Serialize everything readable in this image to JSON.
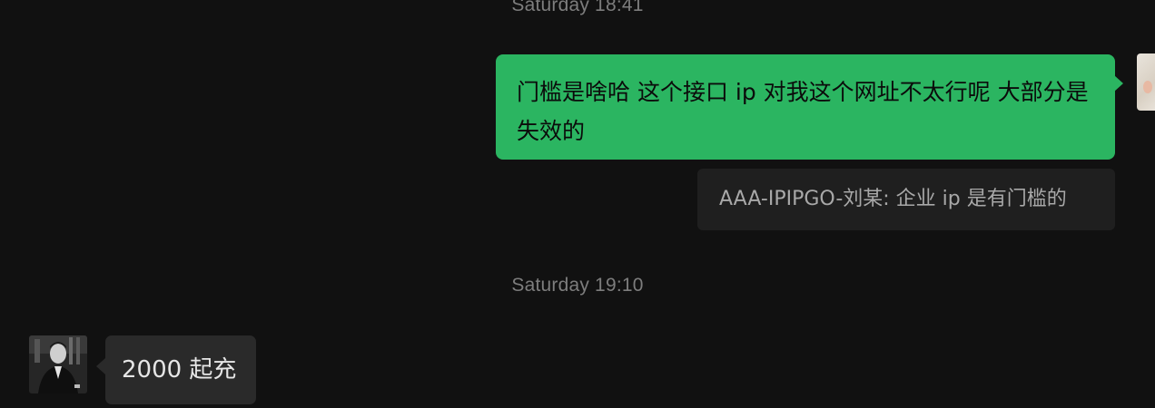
{
  "timestamps": {
    "top": "Saturday 18:41",
    "middle": "Saturday 19:10"
  },
  "messages": {
    "outgoing_text": "门槛是啥哈 这个接口 ip 对我这个网址不太行呢 大部分是失效的",
    "quote_text": "AAA-IPIPGO-刘某: 企业 ip 是有门槛的",
    "incoming_text": "2000 起充"
  },
  "colors": {
    "background": "#111111",
    "outgoing_bubble": "#2bb561",
    "incoming_bubble": "#2a2a2a",
    "quote_bubble": "#1f1f1f",
    "timestamp_text": "#7d7d7d"
  }
}
